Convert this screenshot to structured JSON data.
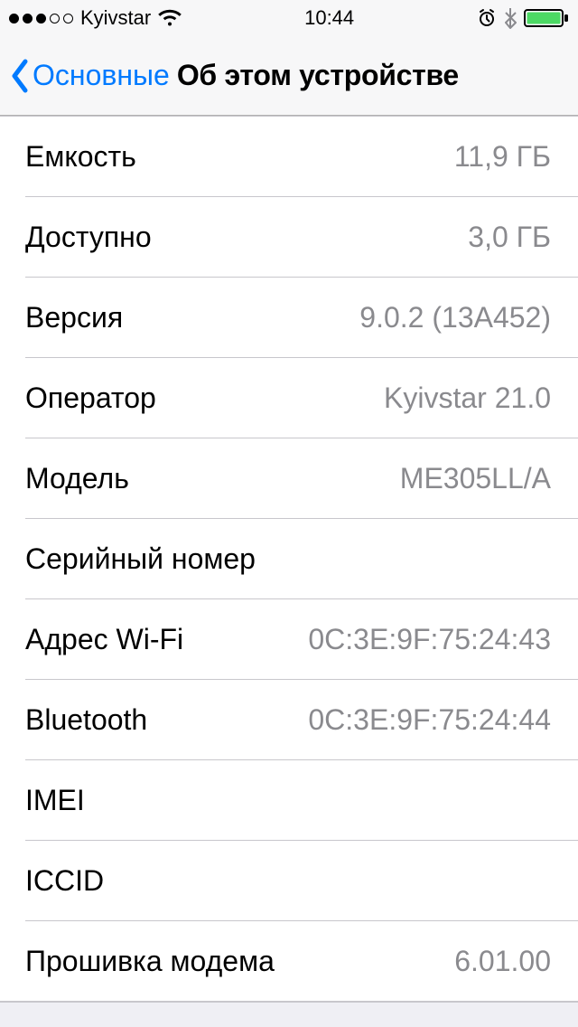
{
  "statusBar": {
    "carrier": "Kyivstar",
    "time": "10:44"
  },
  "nav": {
    "back": "Основные",
    "title": "Об этом устройстве"
  },
  "rows": [
    {
      "label": "Емкость",
      "value": "11,9 ГБ"
    },
    {
      "label": "Доступно",
      "value": "3,0 ГБ"
    },
    {
      "label": "Версия",
      "value": "9.0.2 (13A452)"
    },
    {
      "label": "Оператор",
      "value": "Kyivstar 21.0"
    },
    {
      "label": "Модель",
      "value": "ME305LL/A"
    },
    {
      "label": "Серийный номер",
      "value": ""
    },
    {
      "label": "Адрес Wi-Fi",
      "value": "0C:3E:9F:75:24:43"
    },
    {
      "label": "Bluetooth",
      "value": "0C:3E:9F:75:24:44"
    },
    {
      "label": "IMEI",
      "value": ""
    },
    {
      "label": "ICCID",
      "value": ""
    },
    {
      "label": "Прошивка модема",
      "value": "6.01.00"
    }
  ],
  "colors": {
    "tint": "#007aff",
    "battery": "#4cd964"
  }
}
